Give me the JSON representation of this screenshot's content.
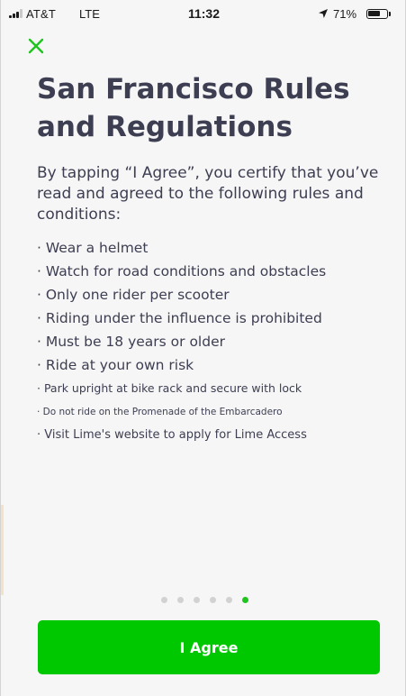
{
  "status_bar": {
    "carrier": "AT&T",
    "network": "LTE",
    "time": "11:32",
    "battery_percent": "71%",
    "battery_level": 0.71,
    "icons": [
      "signal-bars-icon",
      "location-arrow-icon",
      "battery-icon"
    ]
  },
  "close_icon": "close-icon",
  "page": {
    "title": "San Francisco Rules and Regulations",
    "intro": "By tapping “I Agree”, you certify that you’ve read and agreed to the following rules and conditions:",
    "rules": [
      "· Wear a helmet",
      "· Watch for road conditions and obstacles",
      "· Only one rider per scooter",
      "· Riding under the influence is prohibited",
      "· Must be 18 years or older",
      "· Ride at your own risk",
      "· Park upright at bike rack and secure with lock",
      "· Do not ride on the Promenade of the Embarcadero",
      "· Visit Lime's website to apply for Lime Access"
    ]
  },
  "pagination": {
    "total": 6,
    "current": 6
  },
  "agree_button": {
    "label": "I Agree"
  },
  "colors": {
    "accent": "#00c800",
    "text": "#3d3e52",
    "background": "#f6f6f6",
    "dot_inactive": "#d2d2d2"
  }
}
